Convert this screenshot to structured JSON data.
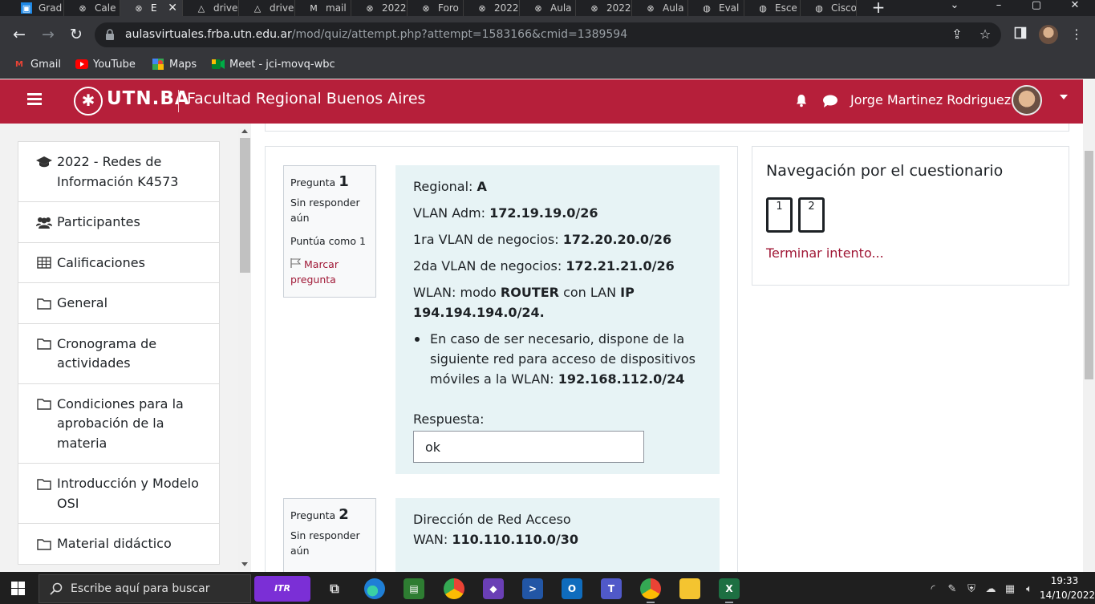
{
  "browser": {
    "tabs": [
      {
        "label": "Grad",
        "icon": "google-classroom-icon",
        "active": false
      },
      {
        "label": "Cale",
        "icon": "close-circle-icon",
        "active": false
      },
      {
        "label": "E",
        "icon": "close-circle-icon",
        "active": true
      },
      {
        "label": "drive",
        "icon": "drive-icon",
        "active": false
      },
      {
        "label": "drive",
        "icon": "drive-icon",
        "active": false
      },
      {
        "label": "mail",
        "icon": "gmail-icon",
        "active": false
      },
      {
        "label": "2022",
        "icon": "close-circle-icon",
        "active": false
      },
      {
        "label": "Foro",
        "icon": "close-circle-icon",
        "active": false
      },
      {
        "label": "2022",
        "icon": "close-circle-icon",
        "active": false
      },
      {
        "label": "Aula",
        "icon": "close-circle-icon",
        "active": false
      },
      {
        "label": "2022",
        "icon": "close-circle-icon",
        "active": false
      },
      {
        "label": "Aula",
        "icon": "close-circle-icon",
        "active": false
      },
      {
        "label": "Eval",
        "icon": "globe-icon",
        "active": false
      },
      {
        "label": "Esce",
        "icon": "globe-icon",
        "active": false
      },
      {
        "label": "Cisco",
        "icon": "globe-icon",
        "active": false
      }
    ],
    "url_host": "aulasvirtuales.frba.utn.edu.ar",
    "url_path": "/mod/quiz/attempt.php?attempt=1583166&cmid=1389594",
    "bookmarks": [
      {
        "label": "Gmail",
        "icon": "gmail-icon"
      },
      {
        "label": "YouTube",
        "icon": "youtube-icon"
      },
      {
        "label": "Maps",
        "icon": "maps-icon"
      },
      {
        "label": "Meet - jci-movq-wbc",
        "icon": "meet-icon"
      }
    ]
  },
  "header": {
    "logo_badge": "✱",
    "logo_text": "UTN.BA",
    "site_name": "Facultad Regional Buenos Aires",
    "user_name": "Jorge Martinez Rodriguez"
  },
  "drawer": {
    "items": [
      {
        "label": "2022 - Redes de Información K4573",
        "icon": "graduation-cap-icon"
      },
      {
        "label": "Participantes",
        "icon": "users-icon"
      },
      {
        "label": "Calificaciones",
        "icon": "table-icon"
      },
      {
        "label": "General",
        "icon": "folder-icon"
      },
      {
        "label": "Cronograma de actividades",
        "icon": "folder-icon"
      },
      {
        "label": "Condiciones para la aprobación de la materia",
        "icon": "folder-icon"
      },
      {
        "label": "Introducción y Modelo OSI",
        "icon": "folder-icon"
      },
      {
        "label": "Material didáctico",
        "icon": "folder-icon"
      }
    ]
  },
  "questions": [
    {
      "label": "Pregunta",
      "number": "1",
      "state": "Sin responder aún",
      "grade": "Puntúa como 1",
      "flag": "Marcar pregunta",
      "lines": [
        {
          "prefix": "Regional: ",
          "bold": "A"
        },
        {
          "prefix": "VLAN Adm: ",
          "bold": "172.19.19.0/26"
        },
        {
          "prefix": "1ra VLAN de negocios: ",
          "bold": "172.20.20.0/26"
        },
        {
          "prefix": "2da VLAN de negocios: ",
          "bold": "172.21.21.0/26"
        }
      ],
      "wlan": {
        "p1": "WLAN: modo ",
        "b1": "ROUTER",
        "p2": " con LAN ",
        "b2": "IP 194.194.194.0/24."
      },
      "bullet": {
        "text": "En caso de ser necesario, dispone de la siguiente red para acceso de dispositivos móviles a la WLAN: ",
        "bold": "192.168.112.0/24"
      },
      "answer_label": "Respuesta:",
      "answer_value": "ok"
    },
    {
      "label": "Pregunta",
      "number": "2",
      "state": "Sin responder aún",
      "text1": "Dirección de Red Acceso",
      "text2_prefix": "WAN: ",
      "text2_bold": "110.110.110.0/30"
    }
  ],
  "quiz_nav": {
    "title": "Navegación por el cuestionario",
    "buttons": [
      "1",
      "2"
    ],
    "finish": "Terminar intento..."
  },
  "taskbar": {
    "search_placeholder": "Escribe aquí para buscar",
    "itr": "ITR",
    "time": "19:33",
    "date": "14/10/2022"
  },
  "colors": {
    "brand": "#b61f3a",
    "link": "#a01836",
    "question_bg": "#e7f3f5"
  }
}
